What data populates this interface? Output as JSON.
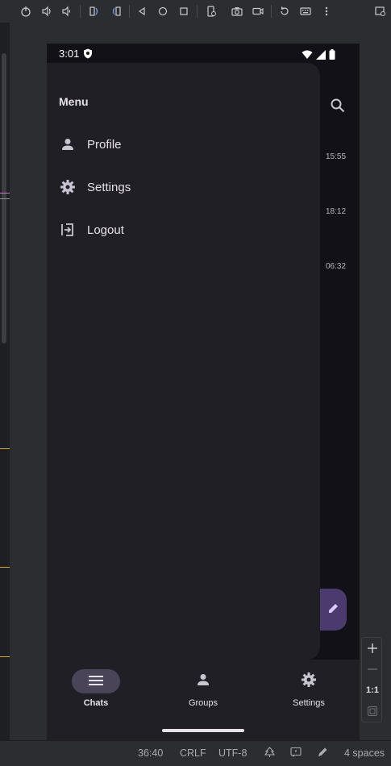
{
  "toolbar": {
    "icons": [
      "power-icon",
      "volume-up-icon",
      "volume-down-icon",
      "rotate-left-icon",
      "rotate-right-icon",
      "back-icon",
      "home-icon",
      "overview-icon",
      "device-settings-icon",
      "camera-icon",
      "screen-record-icon",
      "reset-icon",
      "keyboard-icon",
      "more-icon",
      "window-icon"
    ]
  },
  "device": {
    "status_time": "3:01",
    "drawer": {
      "title": "Menu",
      "items": [
        {
          "label": "Profile",
          "icon": "person-icon"
        },
        {
          "label": "Settings",
          "icon": "gear-icon"
        },
        {
          "label": "Logout",
          "icon": "logout-icon"
        }
      ]
    },
    "times": [
      "15:55",
      "18:12",
      "06:32"
    ],
    "bottom_nav": [
      {
        "label": "Chats",
        "icon": "menu-icon",
        "active": true
      },
      {
        "label": "Groups",
        "icon": "person-icon",
        "active": false
      },
      {
        "label": "Settings",
        "icon": "gear-icon",
        "active": false
      }
    ]
  },
  "zoom": {
    "one_to_one": "1:1"
  },
  "ide_status": {
    "position": "36:40",
    "line_ending": "CRLF",
    "encoding": "UTF-8",
    "indent": "4 spaces"
  },
  "colors": {
    "drawer_bg": "#211f26",
    "device_bg": "#121117",
    "accent": "#4a3a6e",
    "active_pill": "#4a4458"
  }
}
